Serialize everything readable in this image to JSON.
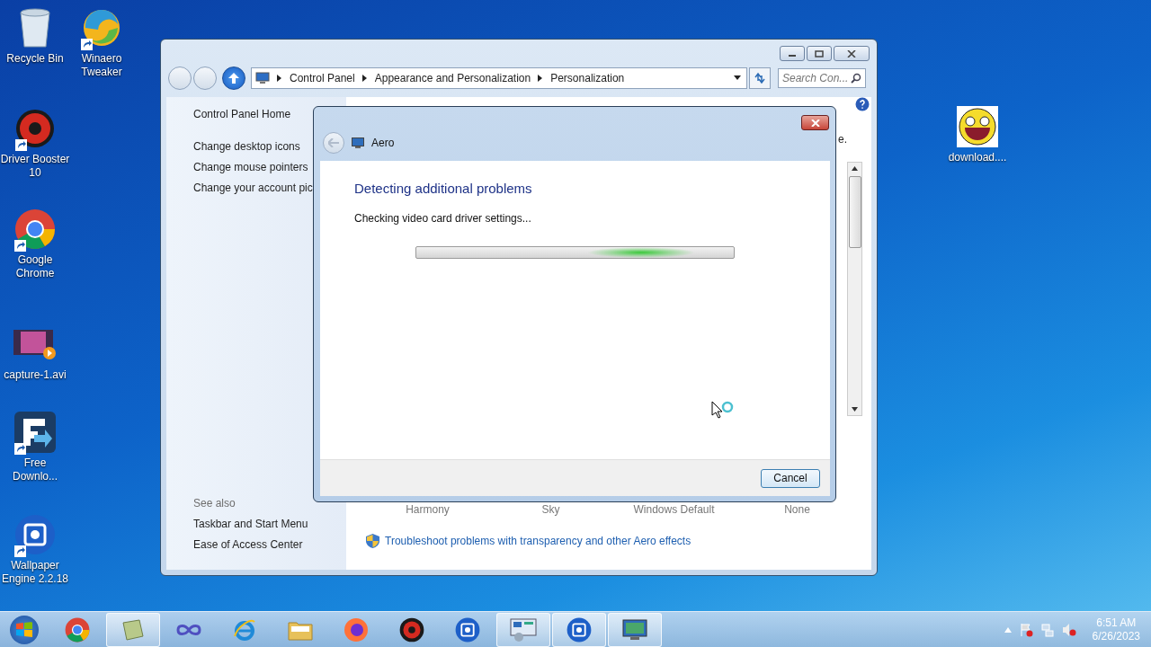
{
  "desktop_icons": [
    {
      "label": "Recycle Bin",
      "kind": "recycle",
      "shortcut": false
    },
    {
      "label": "Winaero Tweaker",
      "kind": "winaero",
      "shortcut": true
    },
    {
      "label": "Driver Booster 10",
      "kind": "booster",
      "shortcut": true
    },
    {
      "label": "Google Chrome",
      "kind": "chrome",
      "shortcut": true
    },
    {
      "label": "capture-1.avi",
      "kind": "video",
      "shortcut": false
    },
    {
      "label": "Free Downlo...",
      "kind": "download",
      "shortcut": true
    },
    {
      "label": "Wallpaper Engine 2.2.18",
      "kind": "wallpaper",
      "shortcut": true
    },
    {
      "label": "download....",
      "kind": "smiley",
      "shortcut": false
    }
  ],
  "explorer": {
    "breadcrumbs": [
      "Control Panel",
      "Appearance and Personalization",
      "Personalization"
    ],
    "search": {
      "placeholder": "Search Con..."
    },
    "sidebar": {
      "home": "Control Panel Home",
      "links": [
        "Change desktop icons",
        "Change mouse pointers",
        "Change your account pic"
      ],
      "see_also_title": "See also",
      "see_also": [
        "Taskbar and Start Menu",
        "Ease of Access Center"
      ]
    },
    "cut_text": "e.",
    "themes": [
      "Harmony",
      "Sky",
      "Windows Default",
      "None"
    ],
    "troubleshoot_link": "Troubleshoot problems with transparency and other Aero effects"
  },
  "dialog": {
    "title": "Aero",
    "heading": "Detecting additional problems",
    "status": "Checking video card driver settings...",
    "progress": {
      "indeterminate": true
    },
    "buttons": [
      "Cancel"
    ]
  },
  "taskbar": {
    "items": [
      {
        "kind": "chrome",
        "open": false
      },
      {
        "kind": "notes",
        "open": true
      },
      {
        "kind": "infinity",
        "open": false
      },
      {
        "kind": "ie",
        "open": false
      },
      {
        "kind": "folder",
        "open": false
      },
      {
        "kind": "firefox",
        "open": false
      },
      {
        "kind": "booster",
        "open": false
      },
      {
        "kind": "wallpaper",
        "open": false
      },
      {
        "kind": "controlpanel",
        "open": true
      },
      {
        "kind": "wallpaper",
        "open": true
      },
      {
        "kind": "aero",
        "open": true
      }
    ],
    "time": "6:51 AM",
    "date": "6/26/2023"
  }
}
